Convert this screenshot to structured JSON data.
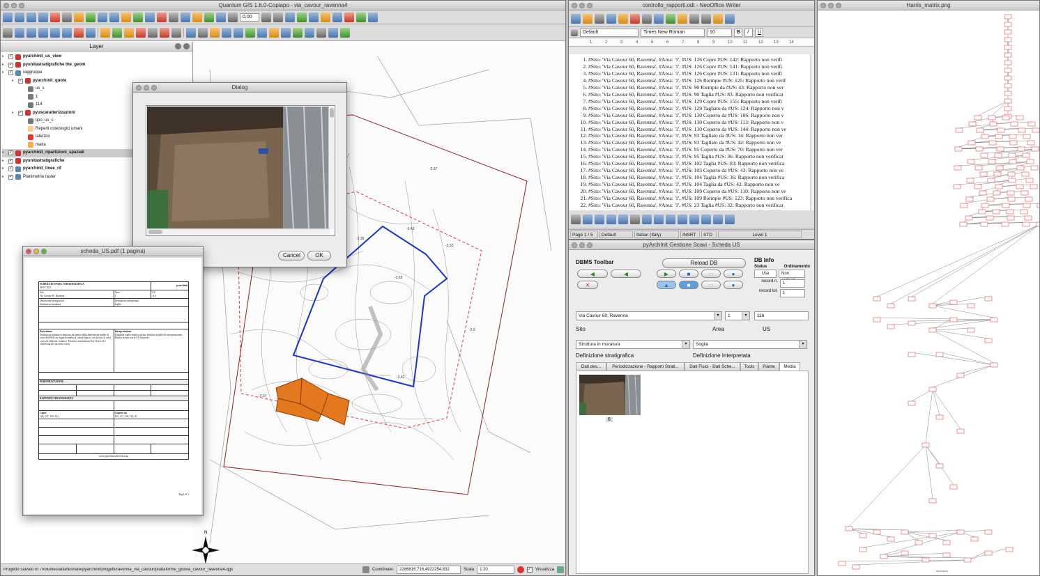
{
  "qgis": {
    "title": "Quantum GIS 1.6.0-Copiapo - via_cavour_ravenna4",
    "zoom_value": "0,00",
    "layer_panel_title": "Layer",
    "layers": [
      {
        "label": "pyarchinit_us_view",
        "bold": true
      },
      {
        "label": "pyunitastratigrafiche the_geom",
        "bold": true
      },
      {
        "label": "raggruppa",
        "bold": false
      },
      {
        "label": "pyarchinit_quote",
        "bold": true
      },
      {
        "label": "us_s",
        "bold": false
      },
      {
        "label": "1",
        "bold": false
      },
      {
        "label": "114",
        "bold": false
      },
      {
        "label": "pyuscaratterizzazioni",
        "bold": true
      },
      {
        "label": "tipo_us_c",
        "bold": false
      },
      {
        "label": "Reperti osteologici umani",
        "bold": false
      },
      {
        "label": "laterizio",
        "bold": false
      },
      {
        "label": "malta",
        "bold": false
      },
      {
        "label": "pyarchinit_ripartizioni_spaziali",
        "bold": true
      },
      {
        "label": "pyunitastratigrafiche",
        "bold": true
      },
      {
        "label": "pyarchinit_linee_rif",
        "bold": true
      },
      {
        "label": "Planimetria raster",
        "bold": false
      }
    ],
    "status_text": "Progetto salvato in: /Volumes/adarteshare/pyarchinit/progetti/ravenna_via_cavour/piattaforme_gis/via_cavour_ravenna4.qgs",
    "coord_label": "Coordinate:",
    "coord_value": "2286816.716,4922254.832",
    "scale_label": "Scala",
    "scale_value": "1:20",
    "render_label": "Visualizza",
    "north_label": "N",
    "map_labels": [
      "-2.57",
      "-3.39",
      "-3.43",
      "-3.53",
      "-3.65",
      "-2.9",
      "-3.42",
      "-2.37"
    ]
  },
  "dialog": {
    "title": "Dialog",
    "cancel_label": "Cancel",
    "ok_label": "OK"
  },
  "pdf": {
    "title": "scheda_US.pdf (1 pagina)",
    "heading": "SCHEDA DI UNITA' STRATIGRAFICA",
    "date": "28-07-2011",
    "logo": "pyarchinit",
    "site_label": "Sito",
    "site_value": "Via Cavour 60, Ravenna",
    "area_label": "Area",
    "area_value": "1",
    "us_label": "US",
    "us_value": "116",
    "def_strat_label": "Definizione stratigrafica",
    "def_strat_value": "Struttura in muratura",
    "def_interp_label": "Definizione Interpretata",
    "def_interp_value": "Soglia",
    "descr_label": "Descrizione",
    "descr_text": "Struttura in muratura composta da laterizi della dimensione medie di circa 40x30x8 cm, legati da malta di colore bianco, con inclusi di calce e piccoli elementi ceramici. Presenta orientamento Est-Ovest ed e' conservata per un unico corso.",
    "interp_label": "Interpretazione",
    "interp_text": "Probabile soglia relativa ad una struttura di difficile interpretazione. Risulta in fase con le US limitrofe.",
    "periodo_label": "PERIODIZZAZIONE",
    "rapporti_label": "RAPPORTI STRATIGRAFICI",
    "copre_label": "Copre",
    "copre_values": "128, 127, 136, 141",
    "coperto_label": "Coperto da",
    "coperto_values": "105, 117, 118, 122, 91",
    "footer_url": "www.pyarchinit.altervista.org",
    "page_label": "Pag 1 di 1"
  },
  "writer": {
    "title": "controllo_rapporti.odt - NeoOffice Writer",
    "style_value": "Default",
    "font_value": "Times New Roman",
    "size_value": "10",
    "bold_label": "B",
    "italic_label": "I",
    "underline_label": "U",
    "ruler_marks": [
      "1",
      "2",
      "3",
      "4",
      "5",
      "6",
      "7",
      "8",
      "9",
      "10",
      "11",
      "12",
      "13",
      "14"
    ],
    "lines": [
      "#Sito: 'Via Cavour 60, Ravenna', #Area: '1', #US: 126 Copre #US: 142: Rapporto non verifi",
      "#Sito: 'Via Cavour 60, Ravenna', #Area: '1', #US: 126 Copre #US: 141: Rapporto non verifi",
      "#Sito: 'Via Cavour 60, Ravenna', #Area: '1', #US: 126 Copre #US: 131: Rapporto non verifi",
      "#Sito: 'Via Cavour 60, Ravenna', #Area: '1', #US: 126 Riempie #US: 125: Rapporto non verif",
      "#Sito: 'Via Cavour 60, Ravenna', #Area: '1', #US: 90 Riempie da #US: 43: Rapporto non ver",
      "#Sito: 'Via Cavour 60, Ravenna', #Area: '1', #US: 90 Taglia #US: 83: Rapporto non verificat",
      "#Sito: 'Via Cavour 60, Ravenna', #Area: '1', #US: 129 Copre #US: 155: Rapporto non verifi",
      "#Sito: 'Via Cavour 60, Ravenna', #Area: '1', #US: 129 Tagliato da #US: 124: Rapporto non v",
      "#Sito: 'Via Cavour 60, Ravenna', #Area: '1', #US: 130 Coperto da #US: 106: Rapporto non v",
      "#Sito: 'Via Cavour 60, Ravenna', #Area: '1', #US: 130 Coperto da #US: 113: Rapporto non v",
      "#Sito: 'Via Cavour 60, Ravenna', #Area: '1', #US: 130 Coperto da #US: 144: Rapporto non ve",
      "#Sito: 'Via Cavour 60, Ravenna', #Area: '1', #US: 93 Tagliato da #US: 14: Rapporto non ver",
      "#Sito: 'Via Cavour 60, Ravenna', #Area: '1', #US: 93 Tagliato da #US: 42: Rapporto non ve",
      "#Sito: 'Via Cavour 60, Ravenna', #Area: '1', #US: 95 Coperto da #US: 70: Rapporto non ver",
      "#Sito: 'Via Cavour 60, Ravenna', #Area: '1', #US: 95 Taglia #US: 36: Rapporto non verificat",
      "#Sito: 'Via Cavour 60, Ravenna', #Area: '1', #US: 102 Taglia #US: 83: Rapporto non verifica",
      "#Sito: 'Via Cavour 60, Ravenna', #Area: '1', #US: 103 Coperto da #US: 43: Rapporto non ve",
      "#Sito: 'Via Cavour 60, Ravenna', #Area: '1', #US: 104 Taglia #US: 36: Rapporto non verifica",
      "#Sito: 'Via Cavour 60, Ravenna', #Area: '1', #US: 104 Taglia da #US: 42: Rapporto non ve",
      "#Sito: 'Via Cavour 60, Ravenna', #Area: '1', #US: 109 Coperto da #US: 110: Rapporto non ve",
      "#Sito: 'Via Cavour 60, Ravenna', #Area: '1', #US: 109 Riempie #US: 123: Rapporto non verifica",
      "#Sito: 'Via Cavour 60, Ravenna', #Area: '1', #US: 23 Taglia #US: 32: Rapporto non verificat"
    ],
    "status": [
      "Page 1 / 5",
      "Default",
      "Italian (Italy)",
      "INSRT",
      "STD",
      "Level 1"
    ]
  },
  "scheda": {
    "title": "pyArchInit Gestione Scavi - Scheda US",
    "dbms_label": "DBMS Toolbar",
    "reload_label": "Reload DB",
    "dbinfo_label": "DB Info",
    "status_label": "Status",
    "status_value": "Usa",
    "ordinamento_label": "Ordinamento",
    "ordinamento_value": "Non ordinati",
    "record_n_label": "record n.",
    "record_n_value": "1",
    "record_tot_label": "record tot.",
    "record_tot_value": "1",
    "site_value": "Via Cavour 60, Ravenna",
    "area_value": "1",
    "us_value": "116",
    "site_label": "Sito",
    "area_label": "Area",
    "us_label": "US",
    "def_strat_value": "Struttura in muratura",
    "def_interp_value": "Soglia",
    "def_strat_label": "Definizione stratigrafica",
    "def_interp_label": "Definizione Interpretata",
    "tabs": [
      "Dati des...",
      "Periodizzazione - Rapporti Strati...",
      "Dati Fisici - Dati Sche...",
      "Tools",
      "Piante",
      "Media"
    ],
    "media_caption": "6"
  },
  "harris": {
    "title": "Harris_matrix.png",
    "bottom_label": "Harris Matrix"
  }
}
